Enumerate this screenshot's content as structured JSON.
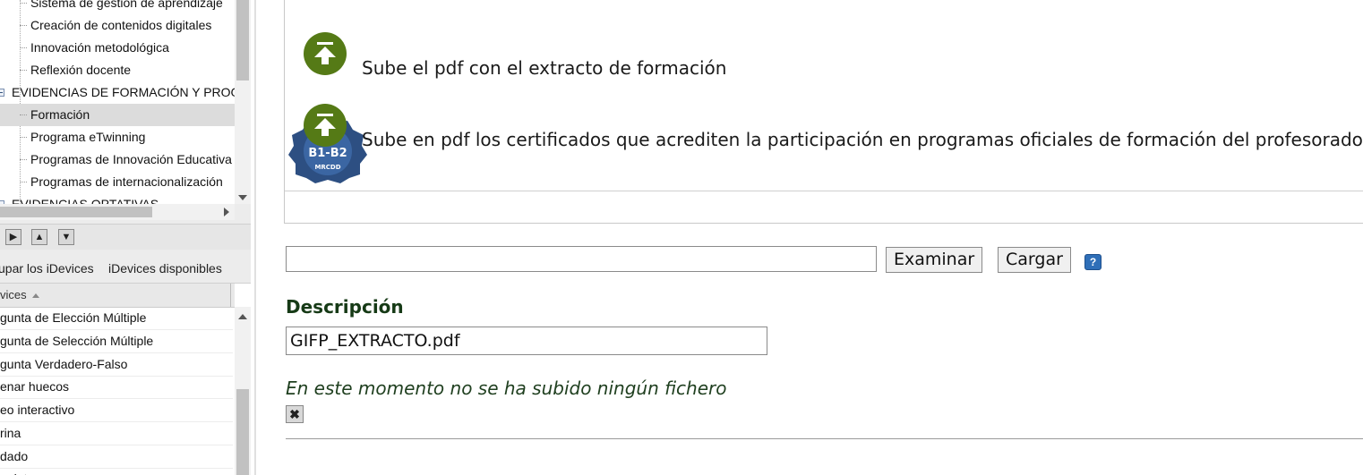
{
  "outline": {
    "items": [
      {
        "label": "Sistema de gestión de aprendizaje",
        "kind": "child"
      },
      {
        "label": "Creación de contenidos digitales",
        "kind": "child"
      },
      {
        "label": "Innovación metodológica",
        "kind": "child"
      },
      {
        "label": "Reflexión docente",
        "kind": "child"
      },
      {
        "label": "EVIDENCIAS DE FORMACIÓN Y PROGRA",
        "kind": "parent"
      },
      {
        "label": "Formación",
        "kind": "child",
        "selected": true
      },
      {
        "label": "Programa eTwinning",
        "kind": "child"
      },
      {
        "label": "Programas de Innovación Educativa",
        "kind": "child"
      },
      {
        "label": "Programas de internacionalización",
        "kind": "child"
      },
      {
        "label": "EVIDENCIAS OPTATIVAS",
        "kind": "parent"
      }
    ]
  },
  "toolbar": {
    "right_glyph": "▶",
    "up_glyph": "▲",
    "down_glyph": "▼"
  },
  "idevice_tabs": {
    "group": "upar los iDevices",
    "available": "iDevices disponibles"
  },
  "idevice_list": {
    "header": "vices",
    "items": [
      "gunta de Elección Múltiple",
      "gunta de Selección Múltiple",
      "gunta Verdadero-Falso",
      "enar huecos",
      "eo interactivo",
      "rina",
      "dado",
      "nplete"
    ]
  },
  "preview": {
    "line1": "Sube el pdf con el extracto de formación",
    "line2": "Sube en pdf los certificados que acrediten la participación en programas oficiales de formación del profesorado",
    "badge": {
      "top": "B1-B2",
      "bottom": "MRCDD"
    }
  },
  "upload": {
    "file_value": "",
    "browse_label": "Examinar",
    "load_label": "Cargar",
    "help_glyph": "?"
  },
  "description": {
    "label": "Descripción",
    "value": "GIFP_EXTRACTO.pdf"
  },
  "status_text": "En este momento no se ha subido ningún fichero",
  "delete_glyph": "✖",
  "colors": {
    "accent_green": "#557a16",
    "help_blue": "#2f6fb8"
  }
}
